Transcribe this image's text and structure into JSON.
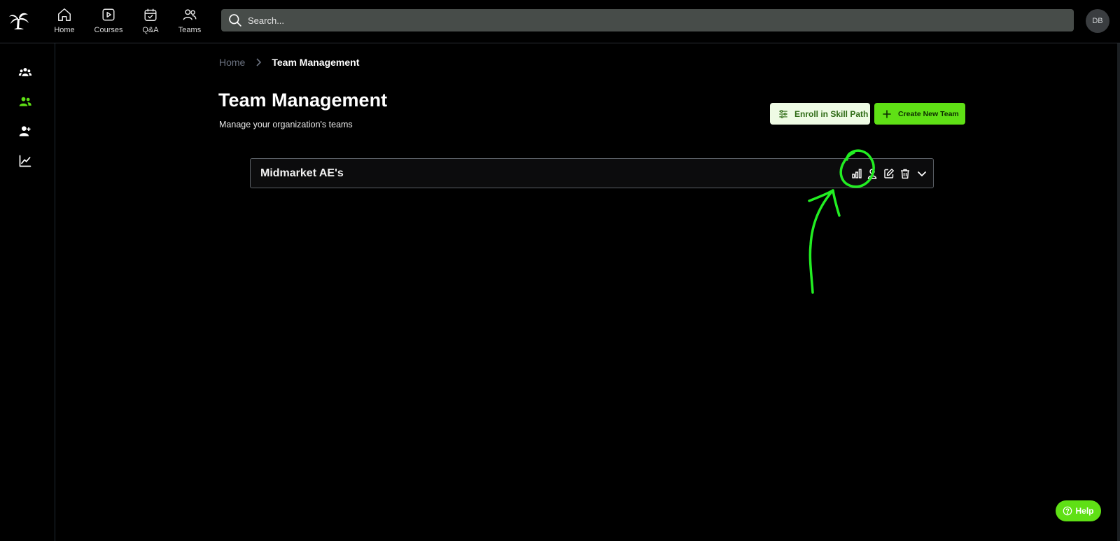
{
  "nav": {
    "items": [
      {
        "label": "Home",
        "icon": "home-icon"
      },
      {
        "label": "Courses",
        "icon": "play-icon"
      },
      {
        "label": "Q&A",
        "icon": "calendar-check-icon"
      },
      {
        "label": "Teams",
        "icon": "users-icon"
      }
    ]
  },
  "search": {
    "placeholder": "Search..."
  },
  "user": {
    "initials": "DB"
  },
  "sidebar": {
    "items": [
      {
        "icon": "team-group-icon",
        "active": false
      },
      {
        "icon": "users-icon",
        "active": true
      },
      {
        "icon": "user-plus-icon",
        "active": false
      },
      {
        "icon": "chart-line-icon",
        "active": false
      }
    ]
  },
  "breadcrumb": {
    "home": "Home",
    "current": "Team Management"
  },
  "page": {
    "title": "Team Management",
    "subtitle": "Manage your organization's teams"
  },
  "actions": {
    "enroll_label": "Enroll in Skill Path",
    "create_label": "Create New Team"
  },
  "teams": [
    {
      "name": "Midmarket AE's"
    }
  ],
  "help": {
    "label": "Help"
  },
  "colors": {
    "accent": "#5fe015",
    "annotation": "#22ee22",
    "background": "#000000"
  }
}
